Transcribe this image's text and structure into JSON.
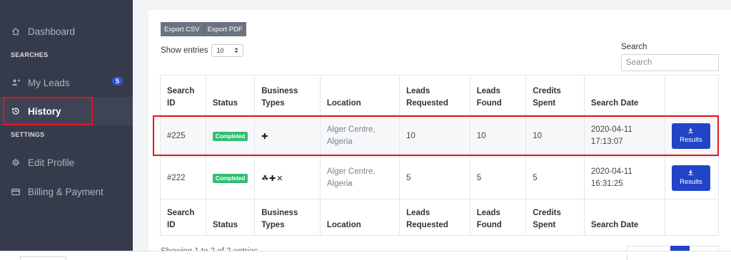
{
  "sidebar": {
    "dashboard": {
      "label": "Dashboard",
      "icon": "home-icon"
    },
    "searches_section": "SEARCHES",
    "my_leads": {
      "label": "My Leads",
      "icon": "users-icon",
      "badge": "5"
    },
    "history": {
      "label": "History",
      "icon": "history-icon"
    },
    "settings_section": "SETTINGS",
    "edit_profile": {
      "label": "Edit Profile",
      "icon": "gear-icon"
    },
    "billing": {
      "label": "Billing & Payment",
      "icon": "credit-card-icon"
    }
  },
  "toolbar": {
    "export_csv": "Export CSV",
    "export_pdf": "Export PDF"
  },
  "entries": {
    "label": "Show entries",
    "value": "10"
  },
  "search": {
    "label": "Search",
    "placeholder": "Search"
  },
  "table": {
    "headers": {
      "search_id": [
        "Search",
        "ID"
      ],
      "status": "Status",
      "business_types": [
        "Business",
        "Types"
      ],
      "location": "Location",
      "leads_requested": [
        "Leads",
        "Requested"
      ],
      "leads_found": [
        "Leads",
        "Found"
      ],
      "credits_spent": [
        "Credits",
        "Spent"
      ],
      "search_date": "Search Date"
    },
    "rows": [
      {
        "id": "#225",
        "status": "Completed",
        "business_types": "✚",
        "location": [
          "Alger Centre,",
          "Algeria"
        ],
        "leads_requested": "10",
        "leads_found": "10",
        "credits_spent": "10",
        "date": "2020-04-11",
        "time": "17:13:07",
        "action": "Results"
      },
      {
        "id": "#222",
        "status": "Completed",
        "business_types": "☘✚✕",
        "location": [
          "Alger Centre,",
          "Algeria"
        ],
        "leads_requested": "5",
        "leads_found": "5",
        "credits_spent": "5",
        "date": "2020-04-11",
        "time": "16:31:25",
        "action": "Results"
      }
    ]
  },
  "footer": {
    "showing": "Showing 1 to 2 of 2 entries"
  },
  "colors": {
    "sidebar_bg": "#363b4b",
    "accent": "#2244c7",
    "status_green": "#2fbf71",
    "highlight": "#e0161b"
  }
}
